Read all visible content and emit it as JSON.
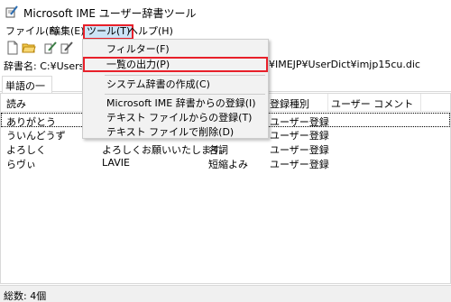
{
  "window": {
    "title": "Microsoft IME ユーザー辞書ツール",
    "icon": "dictionary-pen-icon"
  },
  "menubar": {
    "file": "ファイル(F)",
    "edit": "編集(E)",
    "tools": "ツール(T)",
    "help": "ヘルプ(H)"
  },
  "toolbar": {
    "icons": [
      "new-document-icon",
      "open-folder-icon",
      "edit-word-icon",
      "delete-word-icon"
    ]
  },
  "path": {
    "label": "辞書名: C:¥Users¥",
    "tail": "¥IMEJP¥UserDict¥imjp15cu.dic"
  },
  "tabs": {
    "word_list": "単語の一覧"
  },
  "columns": {
    "reading": "読み",
    "word": "",
    "pos": "",
    "reg_type": "登録種別",
    "comment": "ユーザー コメント"
  },
  "rows": [
    {
      "reading": "ありがとう",
      "word": "",
      "pos": "",
      "reg_type": "ユーザー登録"
    },
    {
      "reading": "ういんどうず",
      "word": "",
      "pos": "",
      "reg_type": "ユーザー登録"
    },
    {
      "reading": "よろしく",
      "word": "よろしくお願いいたします。",
      "pos": "名詞",
      "reg_type": "ユーザー登録"
    },
    {
      "reading": "らヴぃ",
      "word": "LAVIE",
      "pos": "短縮よみ",
      "reg_type": "ユーザー登録"
    }
  ],
  "tools_menu": {
    "filter": "フィルター(F)",
    "export_list": "一覧の出力(P)",
    "create_system_dict": "システム辞書の作成(C)",
    "register_from_ime": "Microsoft IME 辞書からの登録(I)",
    "register_from_text": "テキスト ファイルからの登録(T)",
    "delete_by_text": "テキスト ファイルで削除(D)"
  },
  "status": {
    "total": "総数: 4個"
  },
  "colors": {
    "highlight_border": "#e8202a",
    "menu_active_bg": "#cce4f7"
  }
}
